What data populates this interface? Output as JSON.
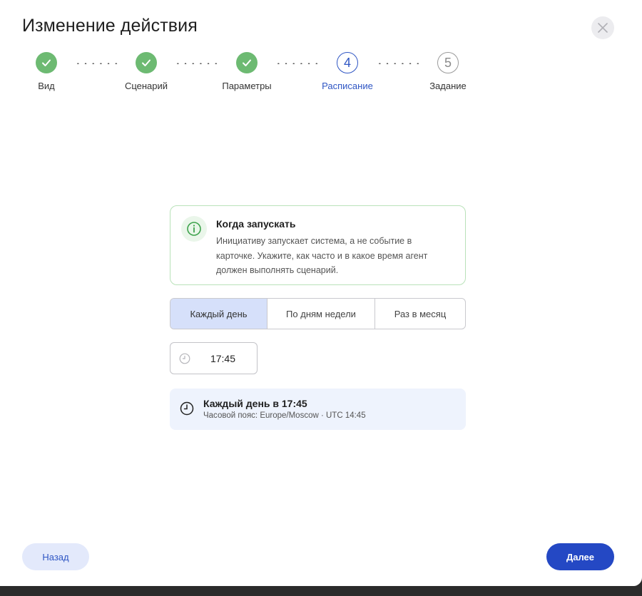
{
  "dialog": {
    "title": "Изменение действия"
  },
  "stepper": {
    "steps": [
      {
        "number": "1",
        "label": "Вид",
        "state": "done"
      },
      {
        "number": "2",
        "label": "Сценарий",
        "state": "done"
      },
      {
        "number": "3",
        "label": "Параметры",
        "state": "done"
      },
      {
        "number": "4",
        "label": "Расписание",
        "state": "active"
      },
      {
        "number": "5",
        "label": "Задание",
        "state": "pending"
      }
    ]
  },
  "info": {
    "title": "Когда запускать",
    "text": "Инициативу запускает система, а не событие в карточке. Укажите, как часто и в какое время агент должен выполнять сценарий."
  },
  "frequency": {
    "options": [
      "Каждый день",
      "По дням недели",
      "Раз в месяц"
    ],
    "selected": "Каждый день"
  },
  "time": {
    "value": "17:45"
  },
  "summary": {
    "title": "Каждый день в 17:45",
    "subtitle": "Часовой пояс: Europe/Moscow · UTC 14:45"
  },
  "footer": {
    "back_label": "Назад",
    "next_label": "Далее"
  },
  "colors": {
    "accent": "#2448c4",
    "done": "#6dba72",
    "segment_active": "#d6e0fa",
    "summary_bg": "#eef3fd"
  }
}
